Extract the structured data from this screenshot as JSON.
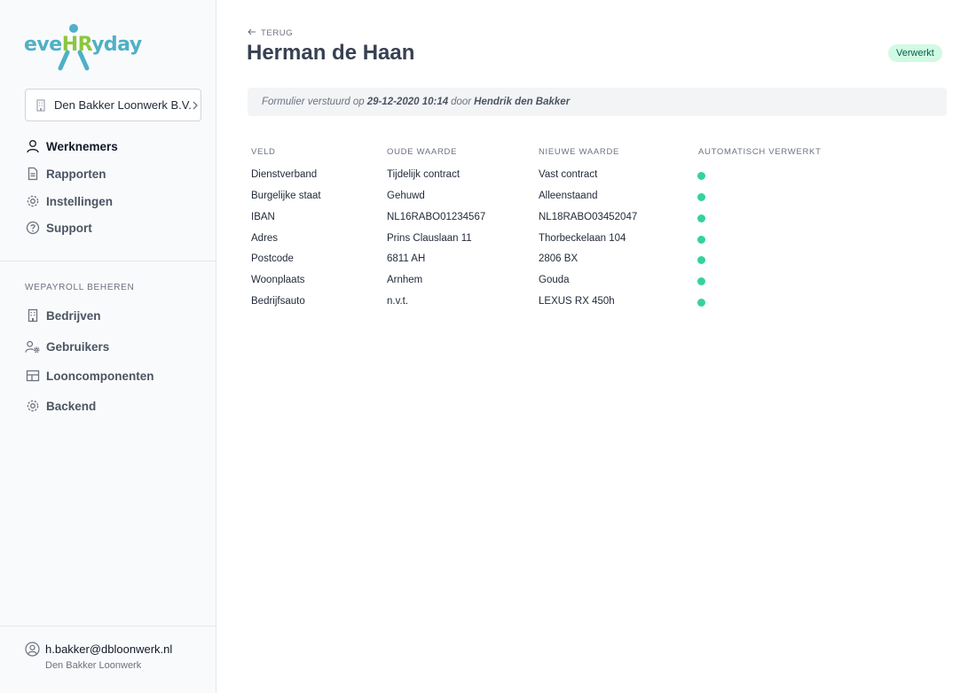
{
  "brand": {
    "logo_pre": "eve",
    "logo_hr": "HR",
    "logo_post": "yday",
    "primary_color": "#4fb0c6",
    "accent_color": "#8cc63f"
  },
  "company_select": {
    "label": "Den Bakker Loonwerk B.V.",
    "icon": "building-icon"
  },
  "nav": [
    {
      "label": "Werknemers",
      "icon": "user-icon",
      "active": true
    },
    {
      "label": "Rapporten",
      "icon": "document-icon"
    },
    {
      "label": "Instellingen",
      "icon": "gear-icon"
    },
    {
      "label": "Support",
      "icon": "help-icon"
    }
  ],
  "admin_section": {
    "title": "WEPAYROLL BEHEREN",
    "items": [
      {
        "label": "Bedrijven",
        "icon": "building-icon"
      },
      {
        "label": "Gebruikers",
        "icon": "user-gear-icon"
      },
      {
        "label": "Looncomponenten",
        "icon": "table-icon"
      },
      {
        "label": "Backend",
        "icon": "gear-icon"
      }
    ]
  },
  "user": {
    "email": "h.bakker@dbloonwerk.nl",
    "org": "Den Bakker Loonwerk"
  },
  "page": {
    "back_label": "TERUG",
    "title": "Herman de Haan",
    "status": "Verwerkt",
    "status_color": "#d1fae5"
  },
  "info": {
    "prefix": "Formulier verstuurd op",
    "datetime": "29-12-2020 10:14",
    "middle": "door",
    "author": "Hendrik den Bakker"
  },
  "table": {
    "headers": [
      "VELD",
      "OUDE WAARDE",
      "NIEUWE WAARDE",
      "AUTOMATISCH VERWERKT"
    ],
    "rows": [
      {
        "field": "Dienstverband",
        "old": "Tijdelijk contract",
        "new": "Vast contract",
        "auto": true
      },
      {
        "field": "Burgelijke staat",
        "old": "Gehuwd",
        "new": "Alleenstaand",
        "auto": true
      },
      {
        "field": "IBAN",
        "old": "NL16RABO01234567",
        "new": "NL18RABO03452047",
        "auto": true
      },
      {
        "field": "Adres",
        "old": "Prins Clauslaan 11",
        "new": "Thorbeckelaan 104",
        "auto": true
      },
      {
        "field": "Postcode",
        "old": "6811 AH",
        "new": "2806 BX",
        "auto": true
      },
      {
        "field": "Woonplaats",
        "old": "Arnhem",
        "new": "Gouda",
        "auto": true
      },
      {
        "field": "Bedrijfsauto",
        "old": "n.v.t.",
        "new": "LEXUS RX 450h",
        "auto": true
      }
    ],
    "status_dot_color": "#34d399"
  }
}
